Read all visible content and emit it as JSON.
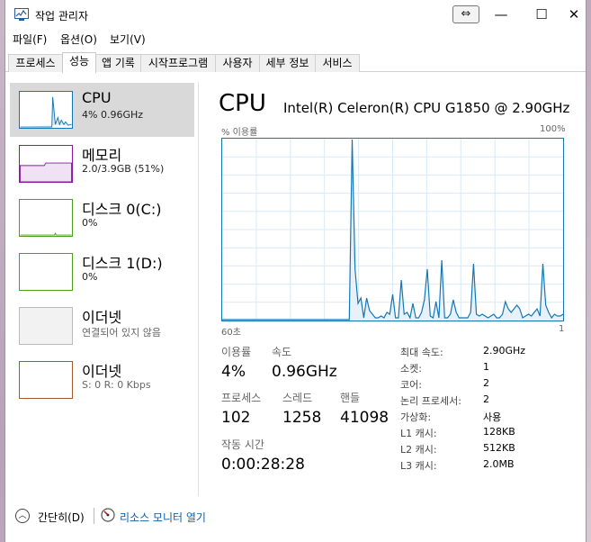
{
  "window": {
    "title": "작업 관리자",
    "resize_glyph": "⇔",
    "controls": {
      "minimize": "—",
      "maximize": "☐",
      "close": "✕"
    }
  },
  "menu": [
    "파일(F)",
    "옵션(O)",
    "보기(V)"
  ],
  "tabs": [
    {
      "label": "프로세스",
      "active": false
    },
    {
      "label": "성능",
      "active": true
    },
    {
      "label": "앱 기록",
      "active": false
    },
    {
      "label": "시작프로그램",
      "active": false
    },
    {
      "label": "사용자",
      "active": false
    },
    {
      "label": "세부 정보",
      "active": false
    },
    {
      "label": "서비스",
      "active": false
    }
  ],
  "resources": [
    {
      "name": "CPU",
      "sub": "4% 0.96GHz",
      "color": "#1477b5",
      "selected": true
    },
    {
      "name": "메모리",
      "sub": "2.0/3.9GB (51%)",
      "color": "#8b16a8",
      "selected": false
    },
    {
      "name": "디스크 0(C:)",
      "sub": "0%",
      "color": "#4c9f1a",
      "selected": false
    },
    {
      "name": "디스크 1(D:)",
      "sub": "0%",
      "color": "#4c9f1a",
      "selected": false
    },
    {
      "name": "이더넷",
      "sub": "연결되어 있지 않음",
      "color": "#aaaaaa",
      "selected": false
    },
    {
      "name": "이더넷",
      "sub": "S: 0 R: 0 Kbps",
      "color": "#a7582a",
      "selected": false
    }
  ],
  "detail": {
    "title": "CPU",
    "model": "Intel(R) Celeron(R) CPU G1850 @ 2.90GHz",
    "graph_label": "% 이용률",
    "graph_max": "100%",
    "graph_span": "60초",
    "graph_min": "1"
  },
  "stats": {
    "utilization_label": "이용률",
    "utilization": "4%",
    "speed_label": "속도",
    "speed": "0.96GHz",
    "processes_label": "프로세스",
    "processes": "102",
    "threads_label": "스레드",
    "threads": "1258",
    "handles_label": "핸들",
    "handles": "41098",
    "uptime_label": "작동 시간",
    "uptime": "0:00:28:28"
  },
  "specs": [
    {
      "label": "최대 속도:",
      "value": "2.90GHz"
    },
    {
      "label": "소켓:",
      "value": "1"
    },
    {
      "label": "코어:",
      "value": "2"
    },
    {
      "label": "논리 프로세서:",
      "value": "2"
    },
    {
      "label": "가상화:",
      "value": "사용"
    },
    {
      "label": "L1 캐시:",
      "value": "128KB"
    },
    {
      "label": "L2 캐시:",
      "value": "512KB"
    },
    {
      "label": "L3 캐시:",
      "value": "2.0MB"
    }
  ],
  "footer": {
    "collapse_label": "간단히(D)",
    "monitor_label": "리소스 모니터 열기"
  },
  "chart_data": {
    "type": "line",
    "xlabel": "",
    "ylabel": "% 이용률",
    "ylim": [
      0,
      100
    ],
    "x_span_seconds": 60,
    "values": [
      0,
      0,
      0,
      0,
      0,
      0,
      0,
      0,
      0,
      0,
      0,
      0,
      0,
      0,
      0,
      0,
      0,
      0,
      0,
      0,
      0,
      0,
      0,
      0,
      0,
      0,
      0,
      0,
      0,
      0,
      0,
      0,
      0,
      0,
      0,
      0,
      0,
      0,
      0,
      0,
      0,
      0,
      0,
      0,
      0,
      100,
      28,
      9,
      12,
      1,
      12,
      5,
      3,
      1,
      1,
      2,
      1,
      4,
      3,
      14,
      1,
      1,
      22,
      3,
      4,
      1,
      9,
      1,
      1,
      4,
      11,
      28,
      2,
      1,
      10,
      1,
      33,
      1,
      1,
      3,
      11,
      4,
      1,
      1,
      1,
      1,
      4,
      31,
      3,
      2,
      3,
      2,
      1,
      2,
      3,
      1,
      1,
      3,
      10,
      6,
      4,
      6,
      8,
      6,
      1,
      2,
      3,
      2,
      4,
      6,
      2,
      31,
      8,
      4,
      1,
      3,
      2,
      2,
      3
    ]
  }
}
